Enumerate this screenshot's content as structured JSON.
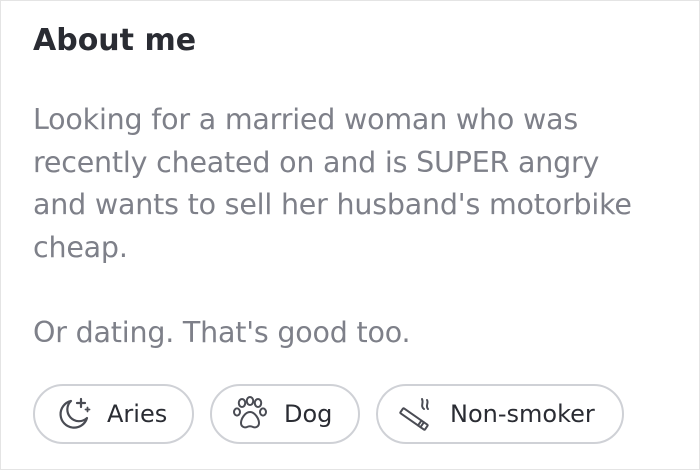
{
  "about": {
    "title": "About me",
    "bio_lines": [
      "Looking for a married woman who was",
      "recently cheated on and is SUPER angry",
      "and wants to sell her husband's motorbike",
      "cheap."
    ],
    "bio_tail": "Or dating. That's good too."
  },
  "tags": [
    {
      "label": "Aries",
      "icon": "crescent-moon-sparkle-icon"
    },
    {
      "label": "Dog",
      "icon": "paw-print-icon"
    },
    {
      "label": "Non-smoker",
      "icon": "cigarette-smoke-icon"
    }
  ],
  "colors": {
    "title": "#2a2c33",
    "bio_text": "#7e8089",
    "chip_border": "#cfd1d6",
    "chip_icon": "#4a4c54",
    "card_border": "#e4e4e4"
  }
}
